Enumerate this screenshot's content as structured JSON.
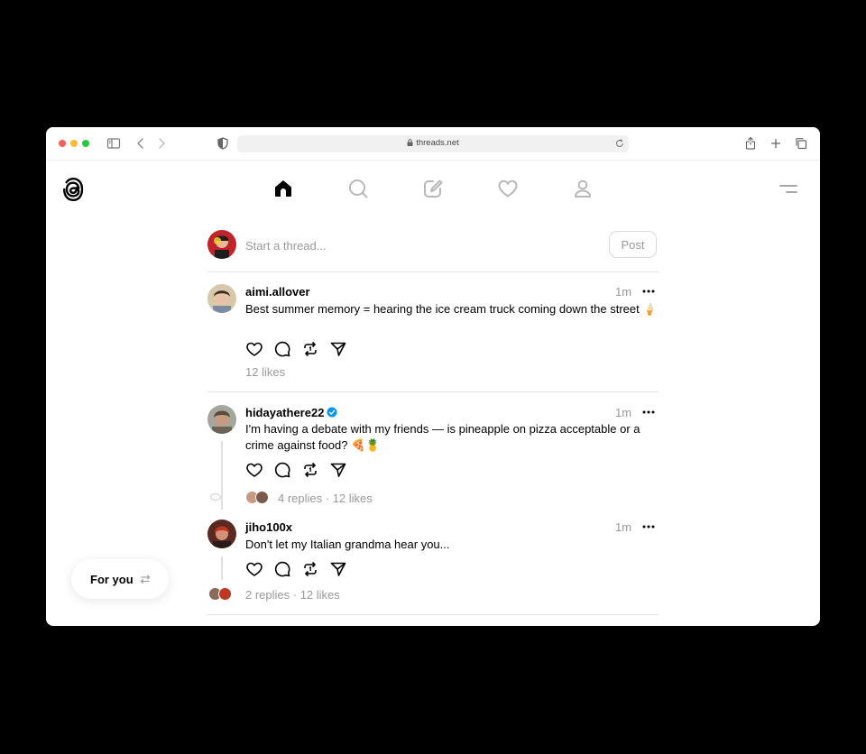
{
  "browser": {
    "url": "threads.net",
    "traffic_lights": [
      "#ff5f57",
      "#febc2e",
      "#28c840"
    ]
  },
  "nav": {
    "icons": [
      "home-icon",
      "search-icon",
      "compose-icon",
      "heart-icon",
      "profile-icon"
    ],
    "active": "home-icon"
  },
  "composer": {
    "placeholder": "Start a thread...",
    "post_label": "Post"
  },
  "posts": [
    {
      "username": "aimi.allover",
      "verified": false,
      "time": "1m",
      "text": "Best summer memory = hearing the ice cream truck coming down the street 🍦",
      "stats": "12 likes"
    },
    {
      "username": "hidayathere22",
      "verified": true,
      "time": "1m",
      "text": "I'm having a debate with my friends — is pineapple on pizza acceptable or a crime against food? 🍕🍍",
      "stats": "4 replies · 12 likes"
    },
    {
      "username": "jiho100x",
      "verified": false,
      "time": "1m",
      "text": "Don't let my Italian grandma hear you...",
      "stats": "2 replies · 12 likes"
    }
  ],
  "feed_switcher": {
    "label": "For you"
  },
  "colors": {
    "verified": "#0095f6",
    "muted_text": "#999999",
    "divider": "#e5e5e5"
  }
}
